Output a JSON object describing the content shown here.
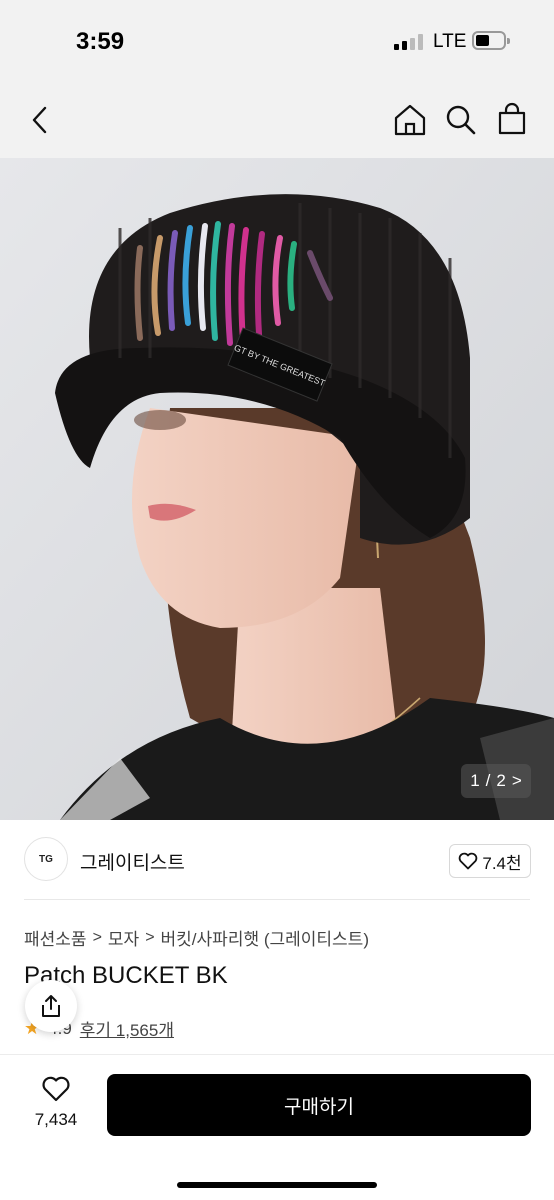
{
  "status_bar": {
    "time": "3:59",
    "network": "LTE"
  },
  "nav": {
    "icons": [
      "back-icon",
      "home-icon",
      "search-icon",
      "shopping-bag-icon"
    ]
  },
  "gallery": {
    "current": "1",
    "separator": "/",
    "total": "2",
    "next_glyph": ">"
  },
  "brand": {
    "logo_text": "TG",
    "name": "그레이티스트",
    "like_count": "7.4천"
  },
  "breadcrumb": [
    "패션소품",
    "모자",
    "버킷/사파리햇 (그레이티스트)"
  ],
  "breadcrumb_sep": ">",
  "product": {
    "title": "Patch BUCKET BK",
    "rating": "4.9",
    "reviews": "후기 1,565개",
    "hat_label": "GT BY THE GREATEST"
  },
  "bottom": {
    "wish_count": "7,434",
    "buy_label": "구매하기"
  },
  "colors": {
    "accent_star": "#f5a623",
    "buy_button": "#000000",
    "status_bg": "#f2f2f2"
  }
}
